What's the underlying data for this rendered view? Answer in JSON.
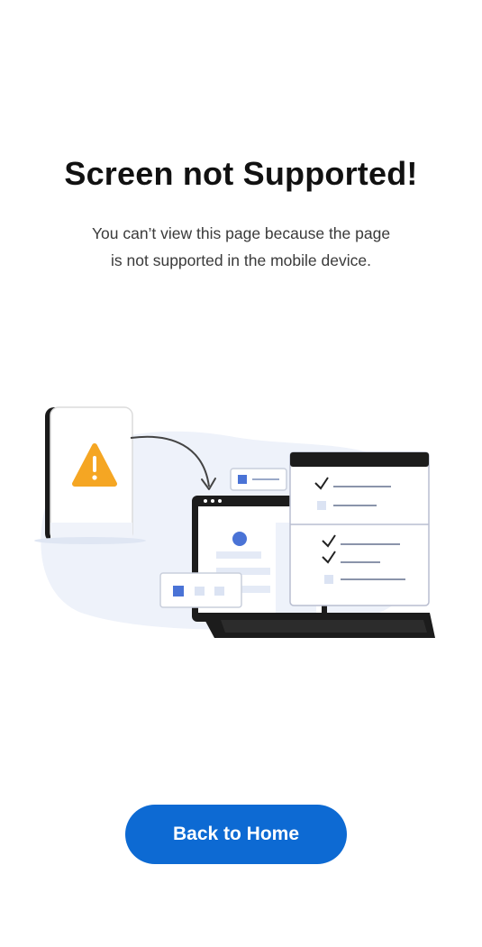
{
  "page": {
    "title": "Screen not Supported!",
    "message_line1": "You can’t view this page because the page",
    "message_line2": "is not supported in the mobile device.",
    "button_label": "Back to Home"
  },
  "colors": {
    "accent": "#0d6ad3",
    "warning": "#f5a623",
    "illustration_blob": "#eef2fa",
    "illustration_blue": "#4a73d6"
  },
  "icons": [
    "phone-icon",
    "warning-icon",
    "arrow-icon",
    "laptop-icon",
    "checklist-icon"
  ]
}
